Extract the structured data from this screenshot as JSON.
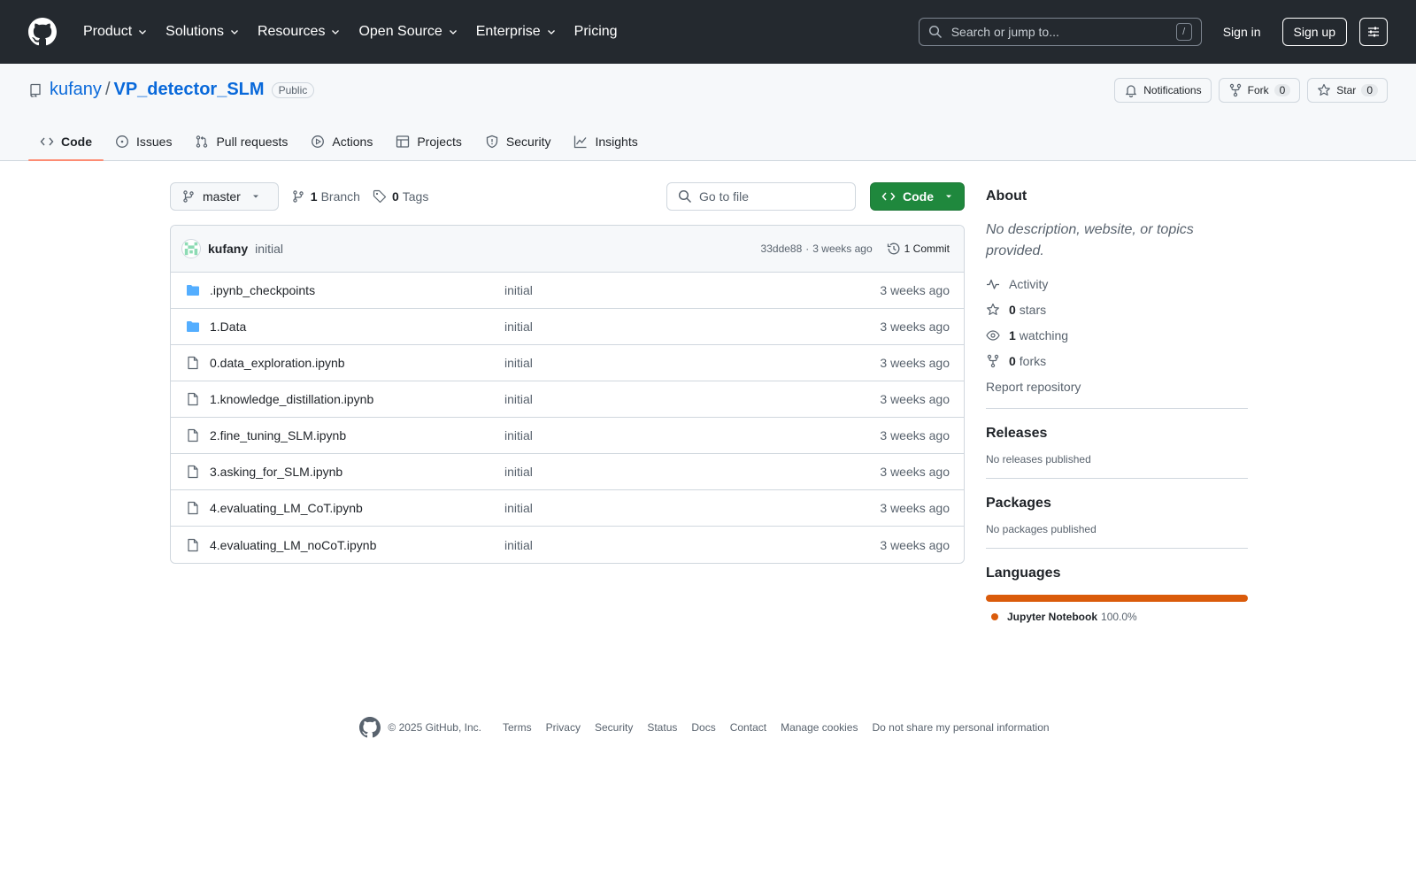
{
  "header": {
    "nav": [
      {
        "label": "Product",
        "dropdown": true
      },
      {
        "label": "Solutions",
        "dropdown": true
      },
      {
        "label": "Resources",
        "dropdown": true
      },
      {
        "label": "Open Source",
        "dropdown": true
      },
      {
        "label": "Enterprise",
        "dropdown": true
      },
      {
        "label": "Pricing",
        "dropdown": false
      }
    ],
    "search_placeholder": "Search or jump to...",
    "search_key": "/",
    "sign_in": "Sign in",
    "sign_up": "Sign up"
  },
  "repo": {
    "owner": "kufany",
    "separator": "/",
    "name": "VP_detector_SLM",
    "visibility": "Public",
    "notifications_label": "Notifications",
    "fork_label": "Fork",
    "fork_count": "0",
    "star_label": "Star",
    "star_count": "0"
  },
  "tabs": [
    {
      "label": "Code",
      "icon": "code-icon",
      "active": true
    },
    {
      "label": "Issues",
      "icon": "issue-icon",
      "active": false
    },
    {
      "label": "Pull requests",
      "icon": "pull-request-icon",
      "active": false
    },
    {
      "label": "Actions",
      "icon": "play-icon",
      "active": false
    },
    {
      "label": "Projects",
      "icon": "table-icon",
      "active": false
    },
    {
      "label": "Security",
      "icon": "shield-icon",
      "active": false
    },
    {
      "label": "Insights",
      "icon": "graph-icon",
      "active": false
    }
  ],
  "toolbar": {
    "branch": "master",
    "branch_count": "1",
    "branch_label": "Branch",
    "tag_count": "0",
    "tag_label": "Tags",
    "go_to_file": "Go to file",
    "code_button": "Code"
  },
  "commit": {
    "author": "kufany",
    "message": "initial",
    "hash": "33dde88",
    "dot": "·",
    "time": "3 weeks ago",
    "count_label": "1 Commit"
  },
  "files": [
    {
      "name": ".ipynb_checkpoints",
      "type": "folder",
      "message": "initial",
      "date": "3 weeks ago"
    },
    {
      "name": "1.Data",
      "type": "folder",
      "message": "initial",
      "date": "3 weeks ago"
    },
    {
      "name": "0.data_exploration.ipynb",
      "type": "file",
      "message": "initial",
      "date": "3 weeks ago"
    },
    {
      "name": "1.knowledge_distillation.ipynb",
      "type": "file",
      "message": "initial",
      "date": "3 weeks ago"
    },
    {
      "name": "2.fine_tuning_SLM.ipynb",
      "type": "file",
      "message": "initial",
      "date": "3 weeks ago"
    },
    {
      "name": "3.asking_for_SLM.ipynb",
      "type": "file",
      "message": "initial",
      "date": "3 weeks ago"
    },
    {
      "name": "4.evaluating_LM_CoT.ipynb",
      "type": "file",
      "message": "initial",
      "date": "3 weeks ago"
    },
    {
      "name": "4.evaluating_LM_noCoT.ipynb",
      "type": "file",
      "message": "initial",
      "date": "3 weeks ago"
    }
  ],
  "about": {
    "title": "About",
    "description": "No description, website, or topics provided.",
    "activity": "Activity",
    "stars_count": "0",
    "stars_label": "stars",
    "watching_count": "1",
    "watching_label": "watching",
    "forks_count": "0",
    "forks_label": "forks",
    "report": "Report repository"
  },
  "releases": {
    "title": "Releases",
    "note": "No releases published"
  },
  "packages": {
    "title": "Packages",
    "note": "No packages published"
  },
  "languages": {
    "title": "Languages",
    "items": [
      {
        "name": "Jupyter Notebook",
        "percent": "100.0%",
        "share": 1.0,
        "color": "#da5b0b"
      }
    ]
  },
  "footer": {
    "copyright": "© 2025 GitHub, Inc.",
    "links": [
      "Terms",
      "Privacy",
      "Security",
      "Status",
      "Docs",
      "Contact",
      "Manage cookies",
      "Do not share my personal information"
    ]
  },
  "colors": {
    "header_bg": "#24292f",
    "accent_link": "#0969da",
    "code_button": "#1f883d",
    "active_tab_underline": "#fd8c73",
    "folder_icon": "#54aeff"
  }
}
